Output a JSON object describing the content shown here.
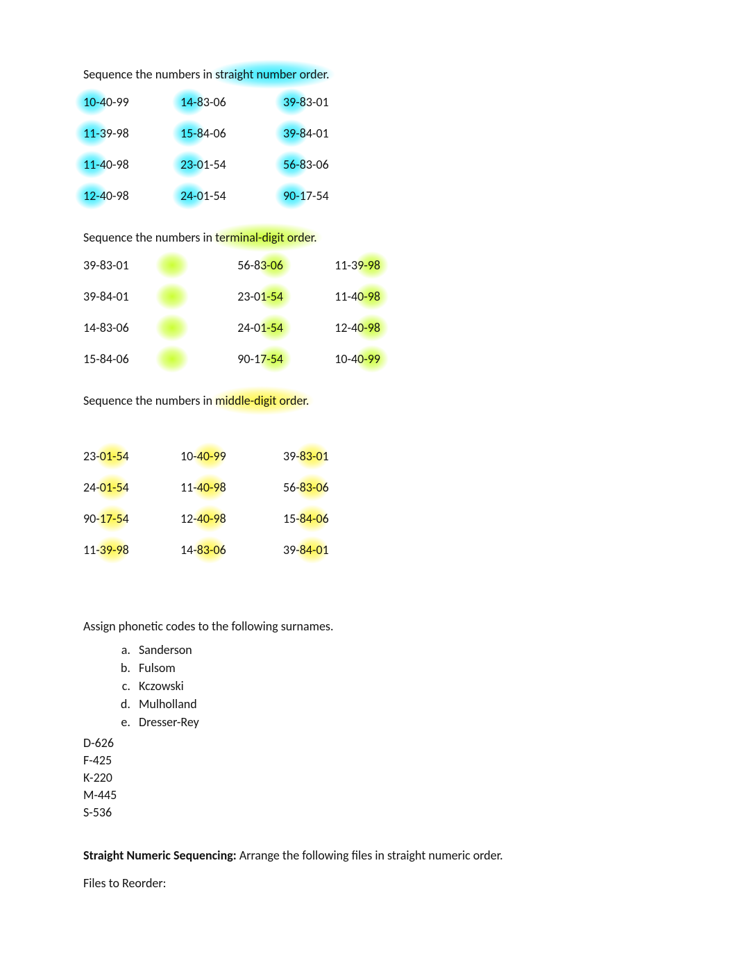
{
  "s1": {
    "prefix": "Sequence the numbers in ",
    "highlight": "straight number order.",
    "grid": [
      [
        "10-40-99",
        "14-83-06",
        "39-83-01"
      ],
      [
        "11-39-98",
        "15-84-06",
        "39-84-01"
      ],
      [
        "11-40-98",
        "23-01-54",
        "56-83-06"
      ],
      [
        "12-40-98",
        "24-01-54",
        "90-17-54"
      ]
    ]
  },
  "s2": {
    "prefix": "Sequence the numbers in ",
    "highlight": "terminal-digit order.",
    "grid": [
      [
        "39-83-01",
        "56-83-06",
        "11-39-98"
      ],
      [
        "39-84-01",
        "23-01-54",
        "11-40-98"
      ],
      [
        "14-83-06",
        "24-01-54",
        "12-40-98"
      ],
      [
        "15-84-06",
        "90-17-54",
        "10-40-99"
      ]
    ]
  },
  "s3": {
    "prefix": "Sequence the numbers in ",
    "highlight": "middle-digit order.",
    "grid": [
      [
        "23-01-54",
        "10-40-99",
        "39-83-01"
      ],
      [
        "24-01-54",
        "11-40-98",
        "56-83-06"
      ],
      [
        "90-17-54",
        "12-40-98",
        "15-84-06"
      ],
      [
        "11-39-98",
        "14-83-06",
        "39-84-01"
      ]
    ]
  },
  "phonetic": {
    "title": "Assign phonetic codes to the following surnames.",
    "surnames": [
      "Sanderson",
      "Fulsom",
      "Kczowski",
      "Mulholland",
      "Dresser-Rey"
    ],
    "codes": [
      "D-626",
      "F-425",
      "K-220",
      "M-445",
      "S-536"
    ]
  },
  "straight": {
    "bold": "Straight Numeric Sequencing: ",
    "rest": "Arrange the following files in straight numeric order.",
    "line2": "Files to Reorder:"
  }
}
